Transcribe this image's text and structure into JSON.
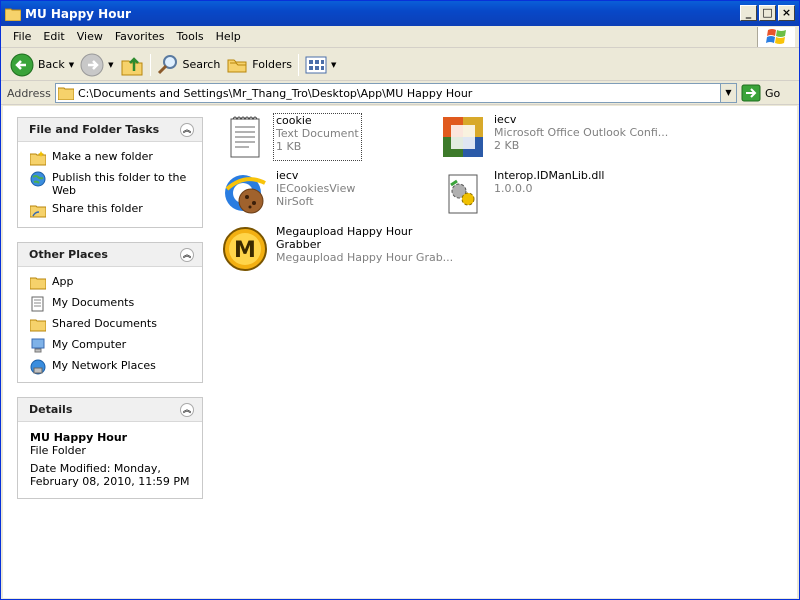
{
  "window": {
    "title": "MU Happy Hour"
  },
  "menu": [
    "File",
    "Edit",
    "View",
    "Favorites",
    "Tools",
    "Help"
  ],
  "toolbar": {
    "back": "Back",
    "search": "Search",
    "folders": "Folders"
  },
  "address": {
    "label": "Address",
    "value": "C:\\Documents and Settings\\Mr_Thang_Tro\\Desktop\\App\\MU Happy Hour",
    "go": "Go"
  },
  "tasks": {
    "title": "File and Folder Tasks",
    "items": [
      {
        "label": "Make a new folder",
        "icon": "new-folder-icon"
      },
      {
        "label": "Publish this folder to the Web",
        "icon": "globe-icon"
      },
      {
        "label": "Share this folder",
        "icon": "share-folder-icon"
      }
    ]
  },
  "places": {
    "title": "Other Places",
    "items": [
      {
        "label": "App",
        "icon": "folder-icon"
      },
      {
        "label": "My Documents",
        "icon": "documents-icon"
      },
      {
        "label": "Shared Documents",
        "icon": "folder-icon"
      },
      {
        "label": "My Computer",
        "icon": "computer-icon"
      },
      {
        "label": "My Network Places",
        "icon": "network-icon"
      }
    ]
  },
  "details": {
    "title": "Details",
    "name": "MU Happy Hour",
    "type": "File Folder",
    "modified_1": "Date Modified: Monday,",
    "modified_2": "February 08, 2010, 11:59 PM"
  },
  "files": [
    {
      "name": "cookie",
      "line2": "Text Document",
      "line3": "1 KB",
      "icon": "text-document-icon"
    },
    {
      "name": "iecv",
      "line2": "Microsoft Office Outlook Confi...",
      "line3": "2 KB",
      "icon": "office-icon"
    },
    {
      "name": "iecv",
      "line2": "IECookiesView",
      "line3": "NirSoft",
      "icon": "ie-cookie-icon"
    },
    {
      "name": "Interop.IDManLib.dll",
      "line2": "1.0.0.0",
      "line3": "",
      "icon": "dll-icon"
    },
    {
      "name_1": "Megaupload Happy Hour",
      "name_2": "Grabber",
      "line2": "Megaupload Happy Hour Grab...",
      "icon": "megaupload-icon"
    }
  ]
}
